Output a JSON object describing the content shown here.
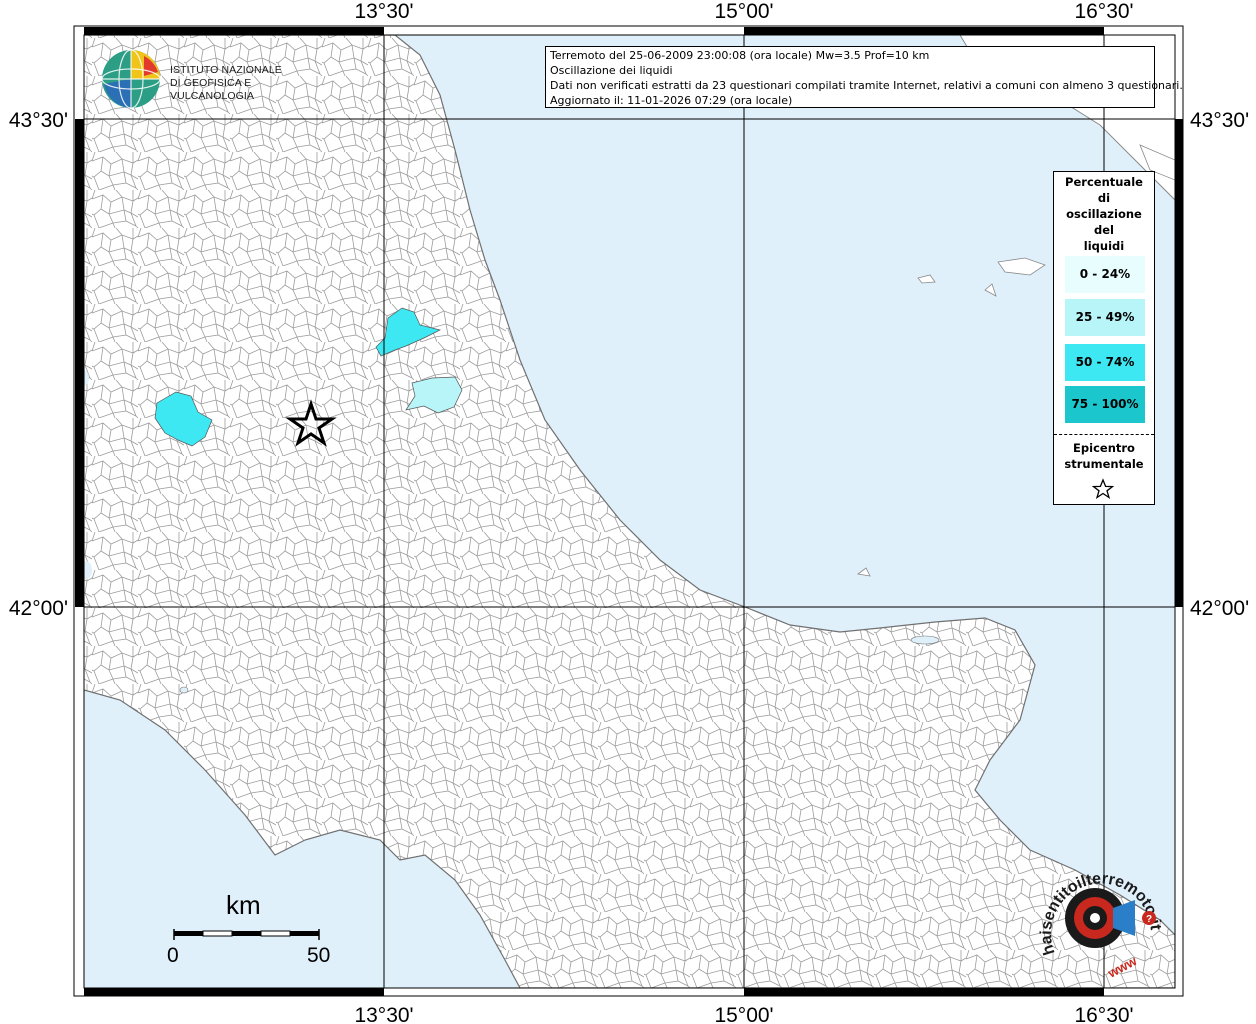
{
  "map": {
    "longitude_ticks": [
      "13°30'",
      "15°00'",
      "16°30'"
    ],
    "latitude_ticks": [
      "43°30'",
      "42°00'"
    ],
    "colors": {
      "sea": "#dff0fb",
      "land": "#ffffff",
      "borders": "#9a9a9a",
      "grid": "#000000"
    }
  },
  "info_box": {
    "line1": "Terremoto del 25-06-2009 23:00:08 (ora locale) Mw=3.5 Prof=10 km",
    "line2": "Oscillazione dei liquidi",
    "line3": "Dati non verificati estratti da 23 questionari compilati tramite Internet, relativi a comuni con almeno 3 questionari.",
    "line4": "Aggiornato il: 11-01-2026 07:29 (ora locale)"
  },
  "logo_ingv": {
    "line1": "ISTITUTO NAZIONALE",
    "line2": "DI GEOFISICA E VULCANOLOGIA"
  },
  "legend": {
    "title_lines": [
      "Percentuale",
      "di",
      "oscillazione",
      "del",
      "liquidi"
    ],
    "classes": [
      {
        "label": "0 - 24%",
        "color": "#e8fdfd"
      },
      {
        "label": "25 - 49%",
        "color": "#b8f5f8"
      },
      {
        "label": "50 - 74%",
        "color": "#3ee8f3"
      },
      {
        "label": "75 - 100%",
        "color": "#1bc6cc"
      }
    ],
    "epicenter_lines": [
      "Epicentro",
      "strumentale"
    ],
    "epicenter_icon": "star-outline-icon"
  },
  "scale_bar": {
    "unit": "km",
    "start_label": "0",
    "end_label": "50"
  },
  "logo_hst": {
    "text_outer": "haisentitoilterremoto.it",
    "text_www": "www",
    "icon": "target-megaphone-icon"
  }
}
